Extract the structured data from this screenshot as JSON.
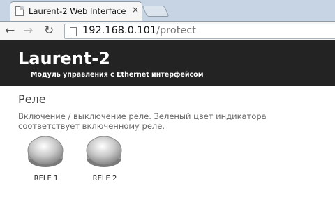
{
  "browser": {
    "tab_title": "Laurent-2 Web Interface",
    "tab_close": "×",
    "url_host": "192.168.0.101",
    "url_path": "/protect",
    "back_icon": "arrow-left-icon",
    "forward_icon": "arrow-right-icon",
    "reload_icon": "reload-icon"
  },
  "header": {
    "title": "Laurent-2",
    "subtitle": "Модуль управления с Ethernet интерфейсом",
    "background_color": "#232323"
  },
  "section": {
    "heading": "Реле",
    "description": "Включение / выключение реле. Зеленый цвет индикатора соответствует включенному реле."
  },
  "relays": [
    {
      "label": "RELE 1",
      "state_color": "#a9a9a9"
    },
    {
      "label": "RELE 2",
      "state_color": "#a9a9a9"
    }
  ]
}
